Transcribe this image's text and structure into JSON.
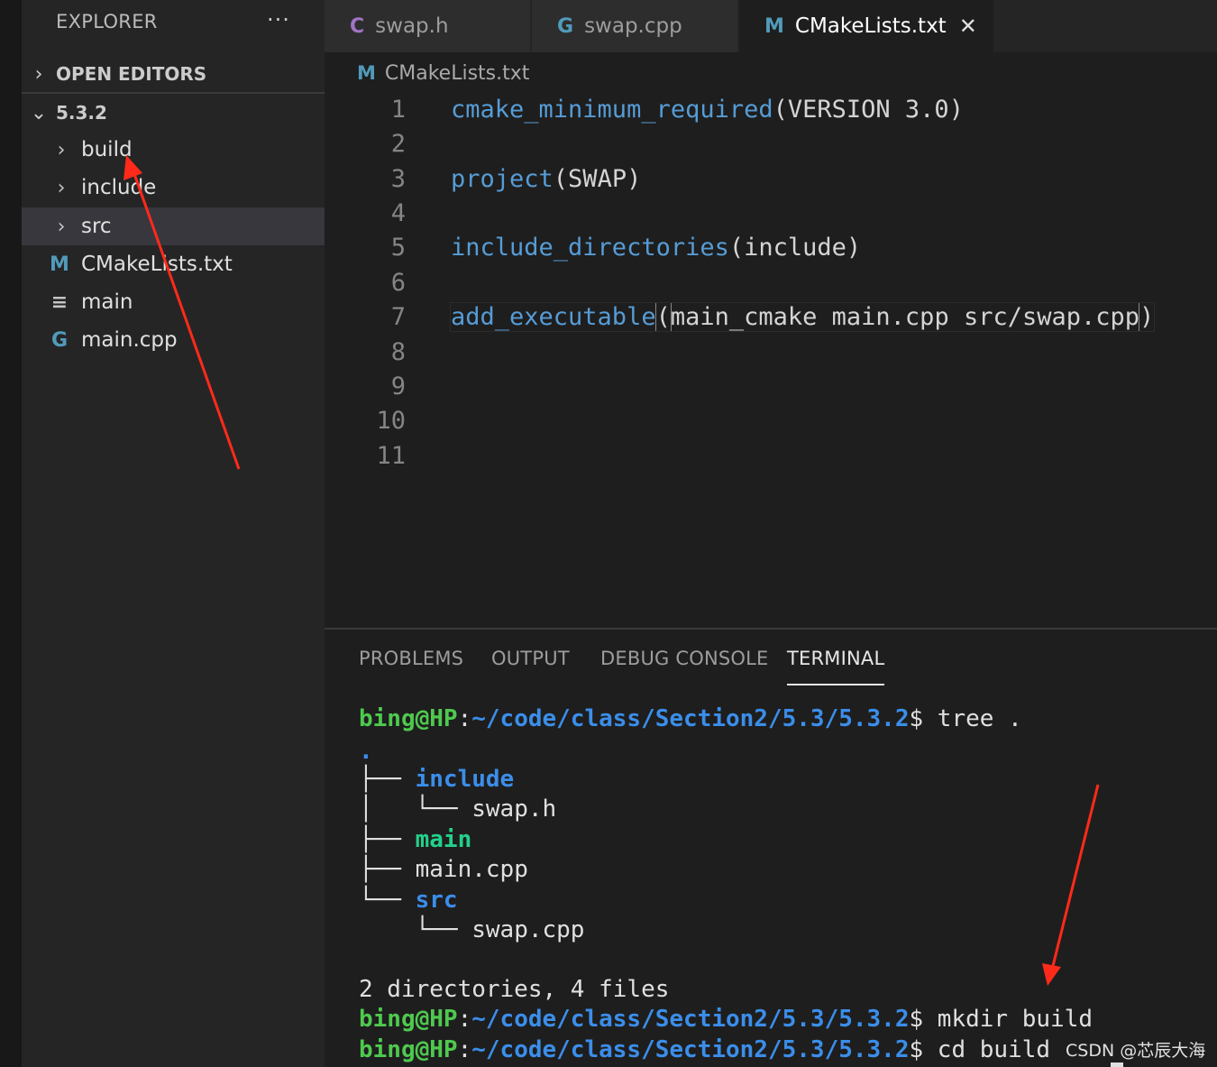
{
  "sidebar": {
    "header": "EXPLORER",
    "more": "···",
    "open_editors": "OPEN EDITORS",
    "folder": "5.3.2",
    "items": [
      {
        "label": "build",
        "type": "folder"
      },
      {
        "label": "include",
        "type": "folder"
      },
      {
        "label": "src",
        "type": "folder"
      },
      {
        "label": "CMakeLists.txt",
        "type": "file",
        "icon": "M"
      },
      {
        "label": "main",
        "type": "file",
        "icon": "≡"
      },
      {
        "label": "main.cpp",
        "type": "file",
        "icon": "G"
      }
    ]
  },
  "tabs": [
    {
      "label": "swap.h",
      "icon": "C"
    },
    {
      "label": "swap.cpp",
      "icon": "G"
    },
    {
      "label": "CMakeLists.txt",
      "icon": "M",
      "close": "✕"
    }
  ],
  "breadcrumb": {
    "icon": "M",
    "label": "CMakeLists.txt"
  },
  "editor": {
    "line_numbers": [
      "1",
      "2",
      "3",
      "4",
      "5",
      "6",
      "7",
      "8",
      "9",
      "10",
      "11"
    ],
    "lines": [
      {
        "fn": "cmake_minimum_required",
        "args": "(VERSION 3.0)"
      },
      {
        "fn": "",
        "args": ""
      },
      {
        "fn": "project",
        "args": "(SWAP)"
      },
      {
        "fn": "",
        "args": ""
      },
      {
        "fn": "include_directories",
        "args": "(include)"
      },
      {
        "fn": "",
        "args": ""
      },
      {
        "fn": "add_executable",
        "open": "(",
        "args": "main_cmake main.cpp src/swap.cpp",
        "close": ")"
      },
      {
        "fn": "",
        "args": ""
      },
      {
        "fn": "",
        "args": ""
      },
      {
        "fn": "",
        "args": ""
      },
      {
        "fn": "",
        "args": ""
      }
    ]
  },
  "panel": {
    "tabs": [
      "PROBLEMS",
      "OUTPUT",
      "DEBUG CONSOLE",
      "TERMINAL"
    ],
    "active_tab": "TERMINAL"
  },
  "terminal": {
    "user": "bing@HP",
    "sep": ":",
    "path": "~/code/class/Section2/5.3/5.3.2",
    "prompt": "$",
    "cmd1": " tree .",
    "tree_root": ".",
    "tree": [
      {
        "prefix": "├── ",
        "name": "include",
        "kind": "dir"
      },
      {
        "prefix": "│   └── ",
        "name": "swap.h",
        "kind": "file"
      },
      {
        "prefix": "├── ",
        "name": "main",
        "kind": "exec"
      },
      {
        "prefix": "├── ",
        "name": "main.cpp",
        "kind": "file"
      },
      {
        "prefix": "└── ",
        "name": "src",
        "kind": "dir"
      },
      {
        "prefix": "    └── ",
        "name": "swap.cpp",
        "kind": "file"
      }
    ],
    "summary": "2 directories, 4 files",
    "cmd2": " mkdir build",
    "cmd3": " cd build"
  },
  "watermark": "CSDN @芯辰大海",
  "colors": {
    "annotation_arrow": "#ff2a1a",
    "terminal_user": "#4ec94e",
    "terminal_path": "#3b8eea",
    "keyword": "#569cd6"
  }
}
